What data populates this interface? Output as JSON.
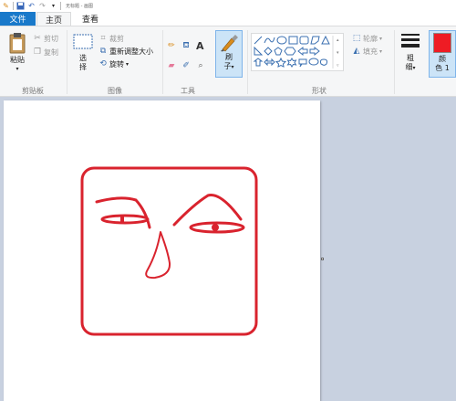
{
  "window": {
    "title": "无标题 - 画图"
  },
  "tabs": {
    "file": "文件",
    "home": "主页",
    "view": "查看"
  },
  "clipboard": {
    "paste": "粘贴",
    "cut": "剪切",
    "copy": "复制",
    "group": "剪贴板"
  },
  "image": {
    "select_top": "选",
    "select_bottom": "择",
    "crop": "裁剪",
    "resize": "重新调整大小",
    "rotate": "旋转",
    "group": "图像"
  },
  "tools": {
    "group": "工具"
  },
  "brushes": {
    "label_top": "刷",
    "label_bottom": "子"
  },
  "shapes": {
    "outline": "轮廓",
    "fill": "填充",
    "group": "形状"
  },
  "size": {
    "label_top": "粗",
    "label_bottom": "细"
  },
  "color1": {
    "label_top": "颜",
    "label_bottom": "色 1",
    "value": "#ee1c24"
  },
  "drawing": {
    "stroke_color": "#d9232e"
  }
}
